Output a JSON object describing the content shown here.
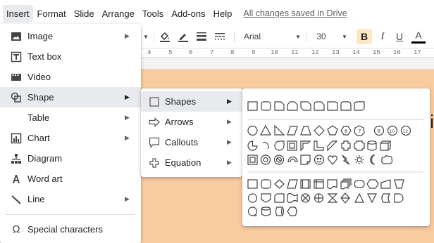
{
  "menubar": {
    "items": [
      "Insert",
      "Format",
      "Slide",
      "Arrange",
      "Tools",
      "Add-ons",
      "Help"
    ],
    "saved_status": "All changes saved in Drive"
  },
  "toolbar": {
    "font": "Arial",
    "font_size": "30",
    "bold": "B",
    "italic": "I",
    "underline": "U",
    "text_color": "A"
  },
  "ruler": {
    "numbers": [
      "4",
      "5",
      "6",
      "7",
      "8",
      "9",
      "10",
      "11",
      "12",
      "13",
      "14",
      "15",
      "16",
      "17"
    ]
  },
  "slide": {
    "partial_text": "hi",
    "background": "#f9cba0"
  },
  "insert_menu": {
    "items": [
      {
        "label": "Image",
        "icon": "image-icon",
        "submenu": true
      },
      {
        "label": "Text box",
        "icon": "text-box-icon",
        "submenu": false
      },
      {
        "label": "Video",
        "icon": "video-icon",
        "submenu": false
      },
      {
        "label": "Shape",
        "icon": "shape-icon",
        "submenu": true,
        "highlighted": true
      },
      {
        "label": "Table",
        "icon": "",
        "submenu": true
      },
      {
        "label": "Chart",
        "icon": "chart-icon",
        "submenu": true
      },
      {
        "label": "Diagram",
        "icon": "diagram-icon",
        "submenu": false
      },
      {
        "label": "Word art",
        "icon": "word-art-icon",
        "submenu": false
      },
      {
        "label": "Line",
        "icon": "line-icon",
        "submenu": true
      },
      {
        "label": "Special characters",
        "icon": "omega-icon",
        "submenu": false
      }
    ]
  },
  "shape_menu": {
    "items": [
      {
        "label": "Shapes",
        "icon": "square-icon",
        "highlighted": true
      },
      {
        "label": "Arrows",
        "icon": "arrow-icon",
        "highlighted": false
      },
      {
        "label": "Callouts",
        "icon": "callout-icon",
        "highlighted": false
      },
      {
        "label": "Equation",
        "icon": "plus-icon",
        "highlighted": false
      }
    ]
  },
  "shapes_panel": {
    "groups": [
      {
        "name": "shapes",
        "count": 10
      },
      {
        "name": "basic",
        "count": 35
      },
      {
        "name": "flowchart",
        "count": 28
      }
    ]
  }
}
